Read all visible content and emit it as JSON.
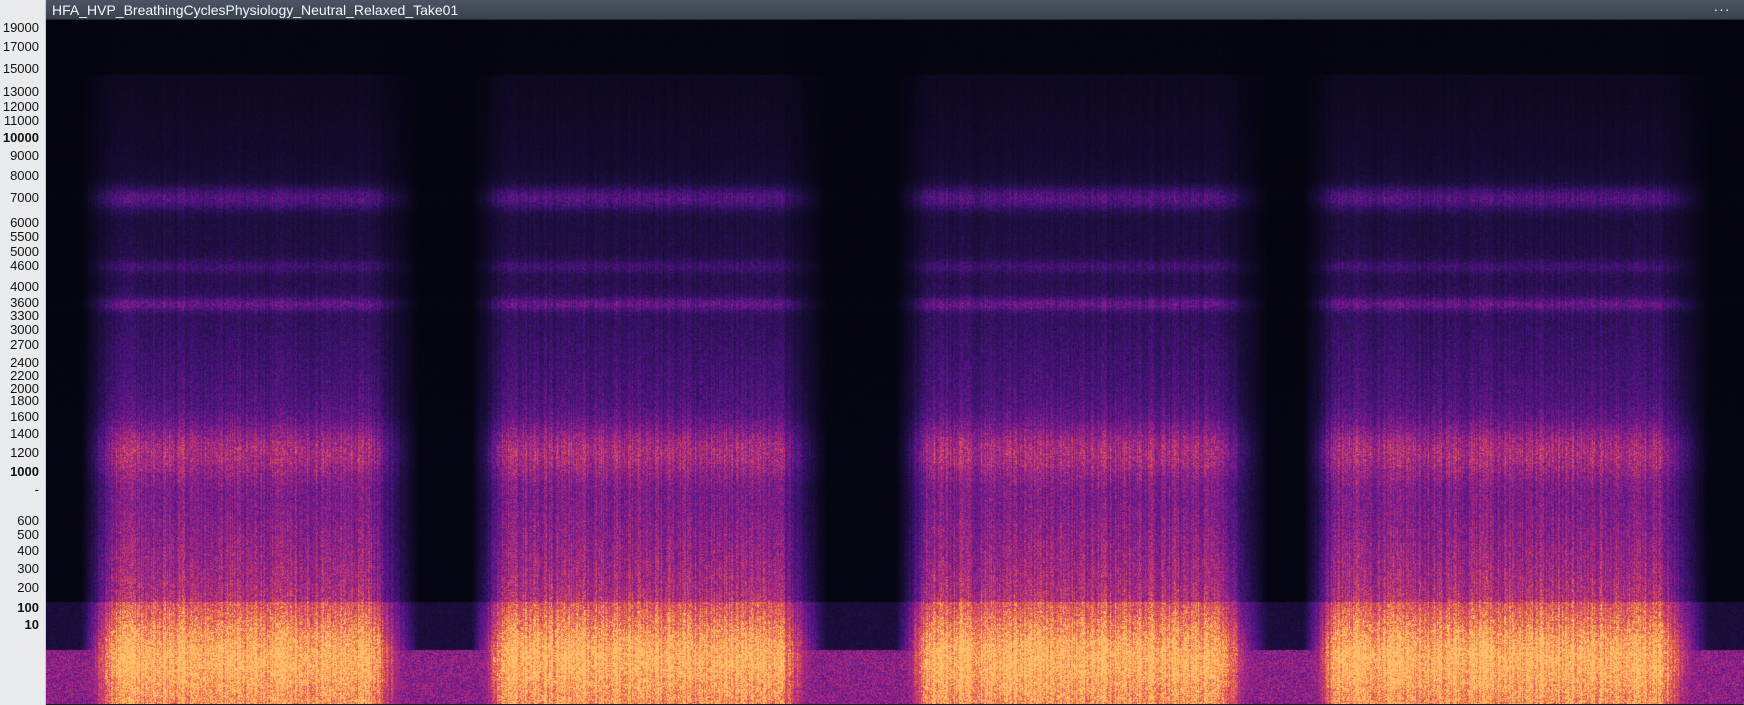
{
  "header": {
    "title": "HFA_HVP_BreathingCyclesPhysiology_Neutral_Relaxed_Take01",
    "menu_icon": "more-dots-icon",
    "menu_label": "···"
  },
  "frequency_axis": {
    "ticks": [
      {
        "label": "19000",
        "hz": 19000,
        "bold": false
      },
      {
        "label": "17000",
        "hz": 17000,
        "bold": false
      },
      {
        "label": "15000",
        "hz": 15000,
        "bold": false
      },
      {
        "label": "13000",
        "hz": 13000,
        "bold": false
      },
      {
        "label": "12000",
        "hz": 12000,
        "bold": false
      },
      {
        "label": "11000",
        "hz": 11000,
        "bold": false
      },
      {
        "label": "10000",
        "hz": 10000,
        "bold": true
      },
      {
        "label": "9000",
        "hz": 9000,
        "bold": false
      },
      {
        "label": "8000",
        "hz": 8000,
        "bold": false
      },
      {
        "label": "7000",
        "hz": 7000,
        "bold": false
      },
      {
        "label": "6000",
        "hz": 6000,
        "bold": false
      },
      {
        "label": "5500",
        "hz": 5500,
        "bold": false
      },
      {
        "label": "5000",
        "hz": 5000,
        "bold": false
      },
      {
        "label": "4600",
        "hz": 4600,
        "bold": false
      },
      {
        "label": "4000",
        "hz": 4000,
        "bold": false
      },
      {
        "label": "3600",
        "hz": 3600,
        "bold": false
      },
      {
        "label": "3300",
        "hz": 3300,
        "bold": false
      },
      {
        "label": "3000",
        "hz": 3000,
        "bold": false
      },
      {
        "label": "2700",
        "hz": 2700,
        "bold": false
      },
      {
        "label": "2400",
        "hz": 2400,
        "bold": false
      },
      {
        "label": "2200",
        "hz": 2200,
        "bold": false
      },
      {
        "label": "2000",
        "hz": 2000,
        "bold": false
      },
      {
        "label": "1800",
        "hz": 1800,
        "bold": false
      },
      {
        "label": "1600",
        "hz": 1600,
        "bold": false
      },
      {
        "label": "1400",
        "hz": 1400,
        "bold": false
      },
      {
        "label": "1200",
        "hz": 1200,
        "bold": false
      },
      {
        "label": "1000",
        "hz": 1000,
        "bold": true
      },
      {
        "label": "-",
        "hz": 800,
        "bold": false
      },
      {
        "label": "600",
        "hz": 600,
        "bold": false
      },
      {
        "label": "500",
        "hz": 500,
        "bold": false
      },
      {
        "label": "400",
        "hz": 400,
        "bold": false
      },
      {
        "label": "300",
        "hz": 300,
        "bold": false
      },
      {
        "label": "200",
        "hz": 200,
        "bold": false
      },
      {
        "label": "100",
        "hz": 100,
        "bold": true
      },
      {
        "label": "10",
        "hz": 10,
        "bold": true
      }
    ]
  },
  "spectrogram": {
    "colormap": [
      "#03040c",
      "#1d0f3f",
      "#4b1480",
      "#8a1e8c",
      "#c93a6e",
      "#f06f3f",
      "#ffc06a"
    ],
    "background": "#03040c",
    "breath_cycles": [
      {
        "start": 0.02,
        "end": 0.22
      },
      {
        "start": 0.25,
        "end": 0.46
      },
      {
        "start": 0.5,
        "end": 0.72
      },
      {
        "start": 0.74,
        "end": 0.98
      }
    ]
  }
}
